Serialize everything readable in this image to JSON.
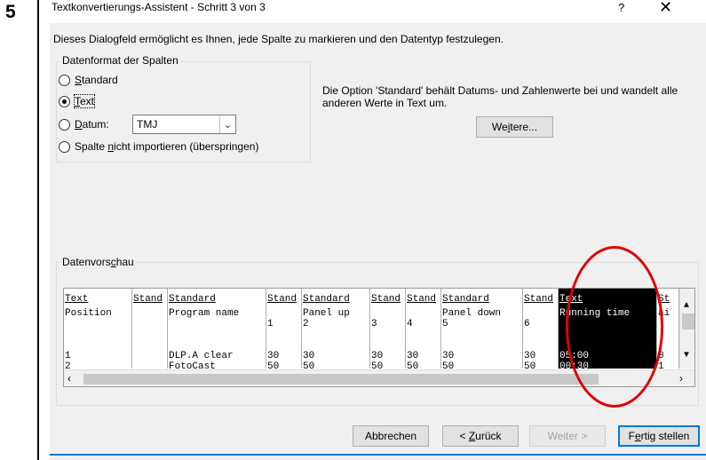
{
  "step": "5",
  "window": {
    "title": "Textkonvertierungs-Assistent - Schritt 3 von 3",
    "help": "?",
    "close": "✕"
  },
  "description": "Dieses Dialogfeld ermöglicht es Ihnen, jede Spalte zu markieren und den Datentyp festzulegen.",
  "format_group": {
    "legend": "Datenformat der Spalten",
    "options": [
      {
        "pre": "",
        "key": "S",
        "post": "tandard",
        "checked": false
      },
      {
        "pre": "",
        "key": "T",
        "post": "ext",
        "checked": true
      },
      {
        "pre": "",
        "key": "D",
        "post": "atum:",
        "checked": false
      },
      {
        "pre": "Spalte ",
        "key": "n",
        "post": "icht importieren (überspringen)",
        "checked": false
      }
    ],
    "date_select_value": "TMJ"
  },
  "info_text": "Die Option 'Standard' behält Datums- und Zahlenwerte bei und wandelt alle anderen Werte in Text um.",
  "advanced_button": {
    "pre": "We",
    "key": "i",
    "post": "tere..."
  },
  "preview": {
    "legend_pre": "Datenvors",
    "legend_key": "c",
    "legend_post": "hau",
    "columns": [
      {
        "header": "Text",
        "cells": [
          "Position",
          "",
          "",
          "1",
          "2"
        ]
      },
      {
        "header": "Stand",
        "cells": [
          "",
          "",
          "",
          "",
          ""
        ]
      },
      {
        "header": "Standard",
        "cells": [
          "Program name",
          "",
          "",
          "DLP.A clear",
          "FotoCast"
        ]
      },
      {
        "header": "Stand",
        "cells": [
          "",
          "1",
          "",
          "30",
          "50"
        ]
      },
      {
        "header": "Standard",
        "cells": [
          "Panel up",
          "2",
          "",
          "30",
          "50"
        ]
      },
      {
        "header": "Stand",
        "cells": [
          "",
          "3",
          "",
          "30",
          "50"
        ]
      },
      {
        "header": "Stand",
        "cells": [
          "",
          "4",
          "",
          "30",
          "50"
        ]
      },
      {
        "header": "Standard",
        "cells": [
          "Panel down",
          "5",
          "",
          "30",
          "50"
        ]
      },
      {
        "header": "Stand",
        "cells": [
          "",
          "6",
          "",
          "30",
          "50"
        ]
      },
      {
        "header": "Text",
        "cells": [
          "Running time",
          "",
          "",
          "05:00",
          "00:30"
        ]
      },
      {
        "header": "St",
        "cells": [
          "ai",
          "",
          "",
          "0",
          "1"
        ]
      }
    ]
  },
  "buttons": {
    "cancel": "Abbrechen",
    "back_pre": "< ",
    "back_key": "Z",
    "back_post": "urück",
    "next": "Weiter >",
    "finish_pre": "F",
    "finish_key": "e",
    "finish_post": "rtig stellen"
  },
  "colors": {
    "annotation": "#e00000",
    "accent": "#0078d7",
    "dialog_bg": "#f0f0f0"
  }
}
